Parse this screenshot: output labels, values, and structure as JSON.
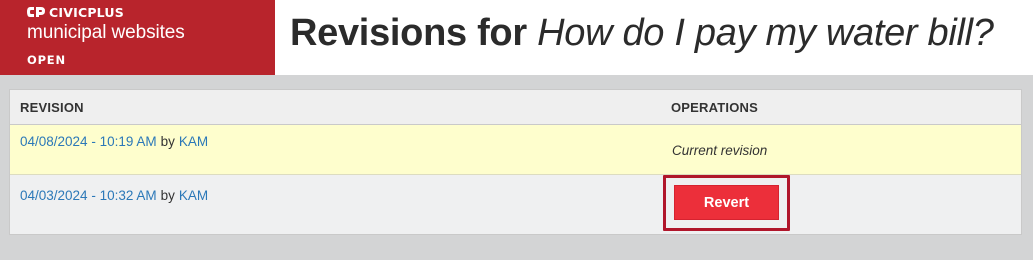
{
  "brand": {
    "name": "CIVICPLUS",
    "product": "municipal websites",
    "tag": "OPEN",
    "icon": "civicplus-logo-icon"
  },
  "page": {
    "title_prefix": "Revisions for ",
    "title_item": "How do I pay my water bill?"
  },
  "table": {
    "headers": [
      "REVISION",
      "OPERATIONS"
    ],
    "rows": [
      {
        "date": "04/08/2024 - 10:19 AM",
        "by": "by",
        "author": "KAM",
        "operation": "Current revision"
      },
      {
        "date": "04/03/2024 - 10:32 AM",
        "by": "by",
        "author": "KAM",
        "operation": "Revert"
      }
    ]
  },
  "colors": {
    "brand_red": "#b8242c",
    "highlight_row": "#fefecd",
    "link": "#2b78b8",
    "revert_button": "#ec2f3a"
  }
}
